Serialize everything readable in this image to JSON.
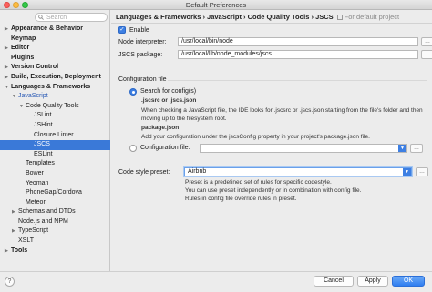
{
  "window": {
    "title": "Default Preferences"
  },
  "sidebar": {
    "search_placeholder": "Search",
    "items": [
      {
        "label": "Appearance & Behavior",
        "bold": true,
        "arrow": "right"
      },
      {
        "label": "Keymap",
        "bold": true
      },
      {
        "label": "Editor",
        "bold": true,
        "arrow": "right"
      },
      {
        "label": "Plugins",
        "bold": true
      },
      {
        "label": "Version Control",
        "bold": true,
        "arrow": "right"
      },
      {
        "label": "Build, Execution, Deployment",
        "bold": true,
        "arrow": "right"
      },
      {
        "label": "Languages & Frameworks",
        "bold": true,
        "arrow": "down"
      },
      {
        "label": "JavaScript",
        "arrow": "down",
        "highlight": true
      },
      {
        "label": "Code Quality Tools",
        "arrow": "down"
      },
      {
        "label": "JSLint"
      },
      {
        "label": "JSHint"
      },
      {
        "label": "Closure Linter"
      },
      {
        "label": "JSCS",
        "selected": true
      },
      {
        "label": "ESLint"
      },
      {
        "label": "Templates"
      },
      {
        "label": "Bower"
      },
      {
        "label": "Yeoman"
      },
      {
        "label": "PhoneGap/Cordova"
      },
      {
        "label": "Meteor"
      },
      {
        "label": "Schemas and DTDs",
        "arrow": "right"
      },
      {
        "label": "Node.js and NPM"
      },
      {
        "label": "TypeScript",
        "arrow": "right"
      },
      {
        "label": "XSLT"
      },
      {
        "label": "Tools",
        "bold": true,
        "arrow": "right"
      }
    ]
  },
  "content": {
    "breadcrumb": "Languages & Frameworks › JavaScript › Code Quality Tools › JSCS",
    "project_note": "For default project",
    "enable_label": "Enable",
    "node_interpreter_label": "Node interpreter:",
    "node_interpreter_value": "/usr/local/bin/node",
    "jscs_package_label": "JSCS package:",
    "jscs_package_value": "/usr/local/lib/node_modules/jscs",
    "config_file_group": "Configuration file",
    "search_configs_label": "Search for config(s)",
    "search_configs_files": ".jscsrc or .jscs.json",
    "search_configs_desc_line1": "When checking a JavaScript file, the IDE looks for .jscsrc or .jscs.json starting from the file's folder and then",
    "search_configs_desc_line2": "moving up to the filesystem root.",
    "package_json_label": "package.json",
    "package_json_desc": "Add your configuration under the jscsConfig property in your project's package.json file.",
    "config_file_label": "Configuration file:",
    "code_style_label": "Code style preset:",
    "code_style_value": "Airbnb",
    "preset_desc_line1": "Preset is a predefined set of rules for specific codestyle.",
    "preset_desc_line2": "You can use preset independently or in combination with config file.",
    "preset_desc_line3": "Rules in config file override rules in preset."
  },
  "buttons": {
    "help": "?",
    "cancel": "Cancel",
    "apply": "Apply",
    "ok": "OK"
  }
}
